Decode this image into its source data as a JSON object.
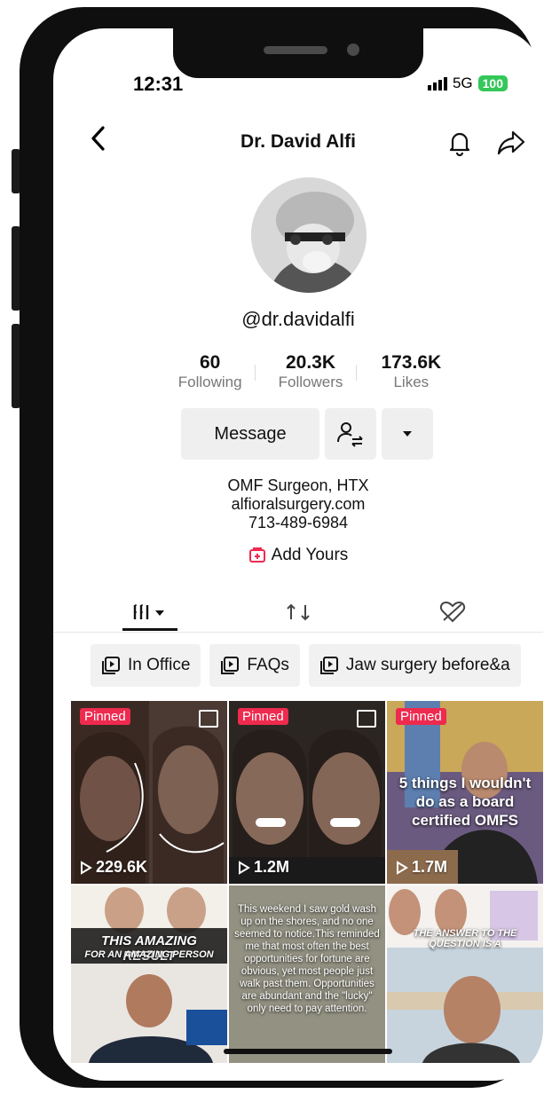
{
  "status": {
    "time": "12:31",
    "network": "5G",
    "battery": "100"
  },
  "header": {
    "title": "Dr. David Alfi"
  },
  "profile": {
    "handle": "@dr.davidalfi",
    "stats": [
      {
        "value": "60",
        "label": "Following"
      },
      {
        "value": "20.3K",
        "label": "Followers"
      },
      {
        "value": "173.6K",
        "label": "Likes"
      }
    ],
    "message_label": "Message",
    "bio": {
      "line1": "OMF Surgeon, HTX",
      "line2": "alfioralsurgery.com",
      "line3": "713-489-6984"
    },
    "add_yours": "Add Yours"
  },
  "playlists": [
    "In Office",
    "FAQs",
    "Jaw surgery before&a"
  ],
  "videos": [
    {
      "pinned": "Pinned",
      "views": "229.6K",
      "overlay": ""
    },
    {
      "pinned": "Pinned",
      "views": "1.2M",
      "overlay": ""
    },
    {
      "pinned": "Pinned",
      "views": "1.7M",
      "overlay": "5 things I wouldn't do as a board certified OMFS"
    },
    {
      "pinned": "",
      "views": "",
      "overlay": "THIS AMAZING RESULT",
      "overlay2": "FOR AN AMAZING PERSON"
    },
    {
      "pinned": "",
      "views": "",
      "overlay": "This weekend I saw gold wash up on the shores, and no one seemed to notice.This reminded me that most often the best opportunities for fortune are obvious, yet most people just walk past them. Opportunities are abundant and the \"lucky\" only need to pay attention."
    },
    {
      "pinned": "",
      "views": "",
      "overlay": "THE ANSWER TO THE QUESTION IS A"
    }
  ],
  "colors": {
    "pinned": "#ee2a4f",
    "battery": "#34c759",
    "accent_pink": "#ee2a4f"
  }
}
